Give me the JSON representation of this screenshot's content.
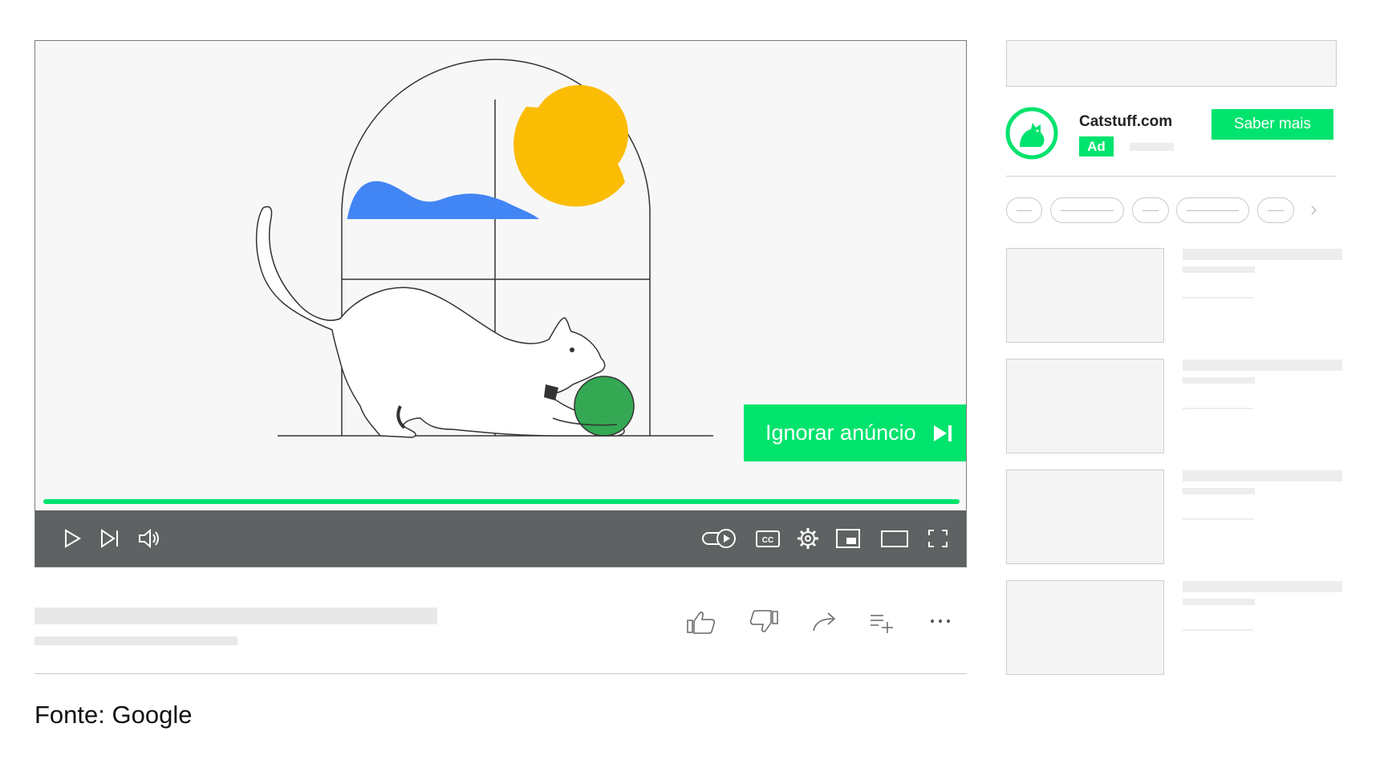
{
  "player": {
    "skip_ad_label": "Ignorar anúncio",
    "ad_progress": 1.0,
    "controls": {
      "play_icon": "play-icon",
      "next_icon": "skip-next-icon",
      "volume_icon": "volume-icon",
      "autoplay_icon": "autoplay-toggle-icon",
      "captions_label": "CC",
      "settings_icon": "gear-icon",
      "miniplayer_icon": "miniplayer-icon",
      "theater_icon": "theater-mode-icon",
      "fullscreen_icon": "fullscreen-icon"
    }
  },
  "video_actions": [
    "like-icon",
    "dislike-icon",
    "share-icon",
    "save-playlist-icon",
    "more-icon"
  ],
  "sidebar": {
    "ad": {
      "domain": "Catstuff.com",
      "badge": "Ad",
      "cta_label": "Saber mais"
    }
  },
  "caption": "Fonte: Google",
  "colors": {
    "accent": "#00e36d",
    "controls_bg": "#5f6263",
    "sun": "#fbbc04",
    "water": "#4285f4",
    "ball": "#34a853"
  }
}
